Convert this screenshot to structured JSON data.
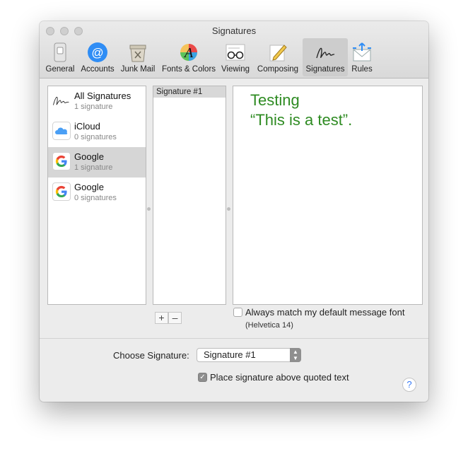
{
  "window": {
    "title": "Signatures"
  },
  "toolbar": {
    "items": [
      {
        "label": "General",
        "icon": "switch-icon"
      },
      {
        "label": "Accounts",
        "icon": "at-sign-icon"
      },
      {
        "label": "Junk Mail",
        "icon": "junk-bin-icon"
      },
      {
        "label": "Fonts & Colors",
        "icon": "font-palette-icon"
      },
      {
        "label": "Viewing",
        "icon": "glasses-icon"
      },
      {
        "label": "Composing",
        "icon": "pencil-paper-icon"
      },
      {
        "label": "Signatures",
        "icon": "signature-icon"
      },
      {
        "label": "Rules",
        "icon": "rules-envelope-icon"
      }
    ],
    "active": "Signatures"
  },
  "accounts": [
    {
      "name": "All Signatures",
      "count": "1 signature",
      "icon": "signature-icon"
    },
    {
      "name": "iCloud",
      "count": "0 signatures",
      "icon": "cloud-icon"
    },
    {
      "name": "Google",
      "count": "1 signature",
      "icon": "google-icon",
      "selected": true
    },
    {
      "name": "Google",
      "count": "0 signatures",
      "icon": "google-icon"
    }
  ],
  "signatures": [
    {
      "name": "Signature #1",
      "selected": true
    }
  ],
  "preview": {
    "line1": "Testing",
    "line2": "“This is a test”.",
    "color": "#2e8b22"
  },
  "controls": {
    "add": "+",
    "remove": "–",
    "match_font_label": "Always match my default message font",
    "match_font_checked": false,
    "font_hint": "(Helvetica 14)",
    "choose_label": "Choose Signature:",
    "choose_value": "Signature #1",
    "place_above_label": "Place signature above quoted text",
    "place_above_checked": true,
    "help": "?"
  }
}
